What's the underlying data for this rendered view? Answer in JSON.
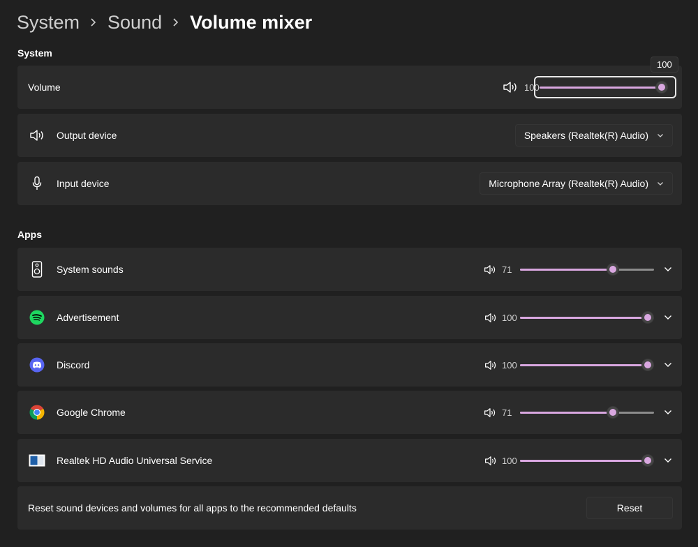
{
  "breadcrumb": {
    "items": [
      "System",
      "Sound"
    ],
    "current": "Volume mixer"
  },
  "system": {
    "section_label": "System",
    "volume": {
      "label": "Volume",
      "value": "100",
      "level": 1.0,
      "tooltip": "100"
    },
    "output": {
      "label": "Output device",
      "selected": "Speakers (Realtek(R) Audio)"
    },
    "input": {
      "label": "Input device",
      "selected": "Microphone Array (Realtek(R) Audio)"
    }
  },
  "apps": {
    "section_label": "Apps",
    "items": [
      {
        "name": "System sounds",
        "icon": "system-sounds-icon",
        "value": "71",
        "level": 0.71
      },
      {
        "name": "Advertisement",
        "icon": "spotify-icon",
        "value": "100",
        "level": 1.0
      },
      {
        "name": "Discord",
        "icon": "discord-icon",
        "value": "100",
        "level": 1.0
      },
      {
        "name": "Google Chrome",
        "icon": "chrome-icon",
        "value": "71",
        "level": 0.71
      },
      {
        "name": "Realtek HD Audio Universal Service",
        "icon": "realtek-icon",
        "value": "100",
        "level": 1.0
      }
    ]
  },
  "reset": {
    "label": "Reset sound devices and volumes for all apps to the recommended defaults",
    "button": "Reset"
  },
  "colors": {
    "accent": "#d9a7e0",
    "background": "#202020",
    "card": "#2b2b2b",
    "spotify": "#1ed760",
    "discord": "#5865f2"
  }
}
